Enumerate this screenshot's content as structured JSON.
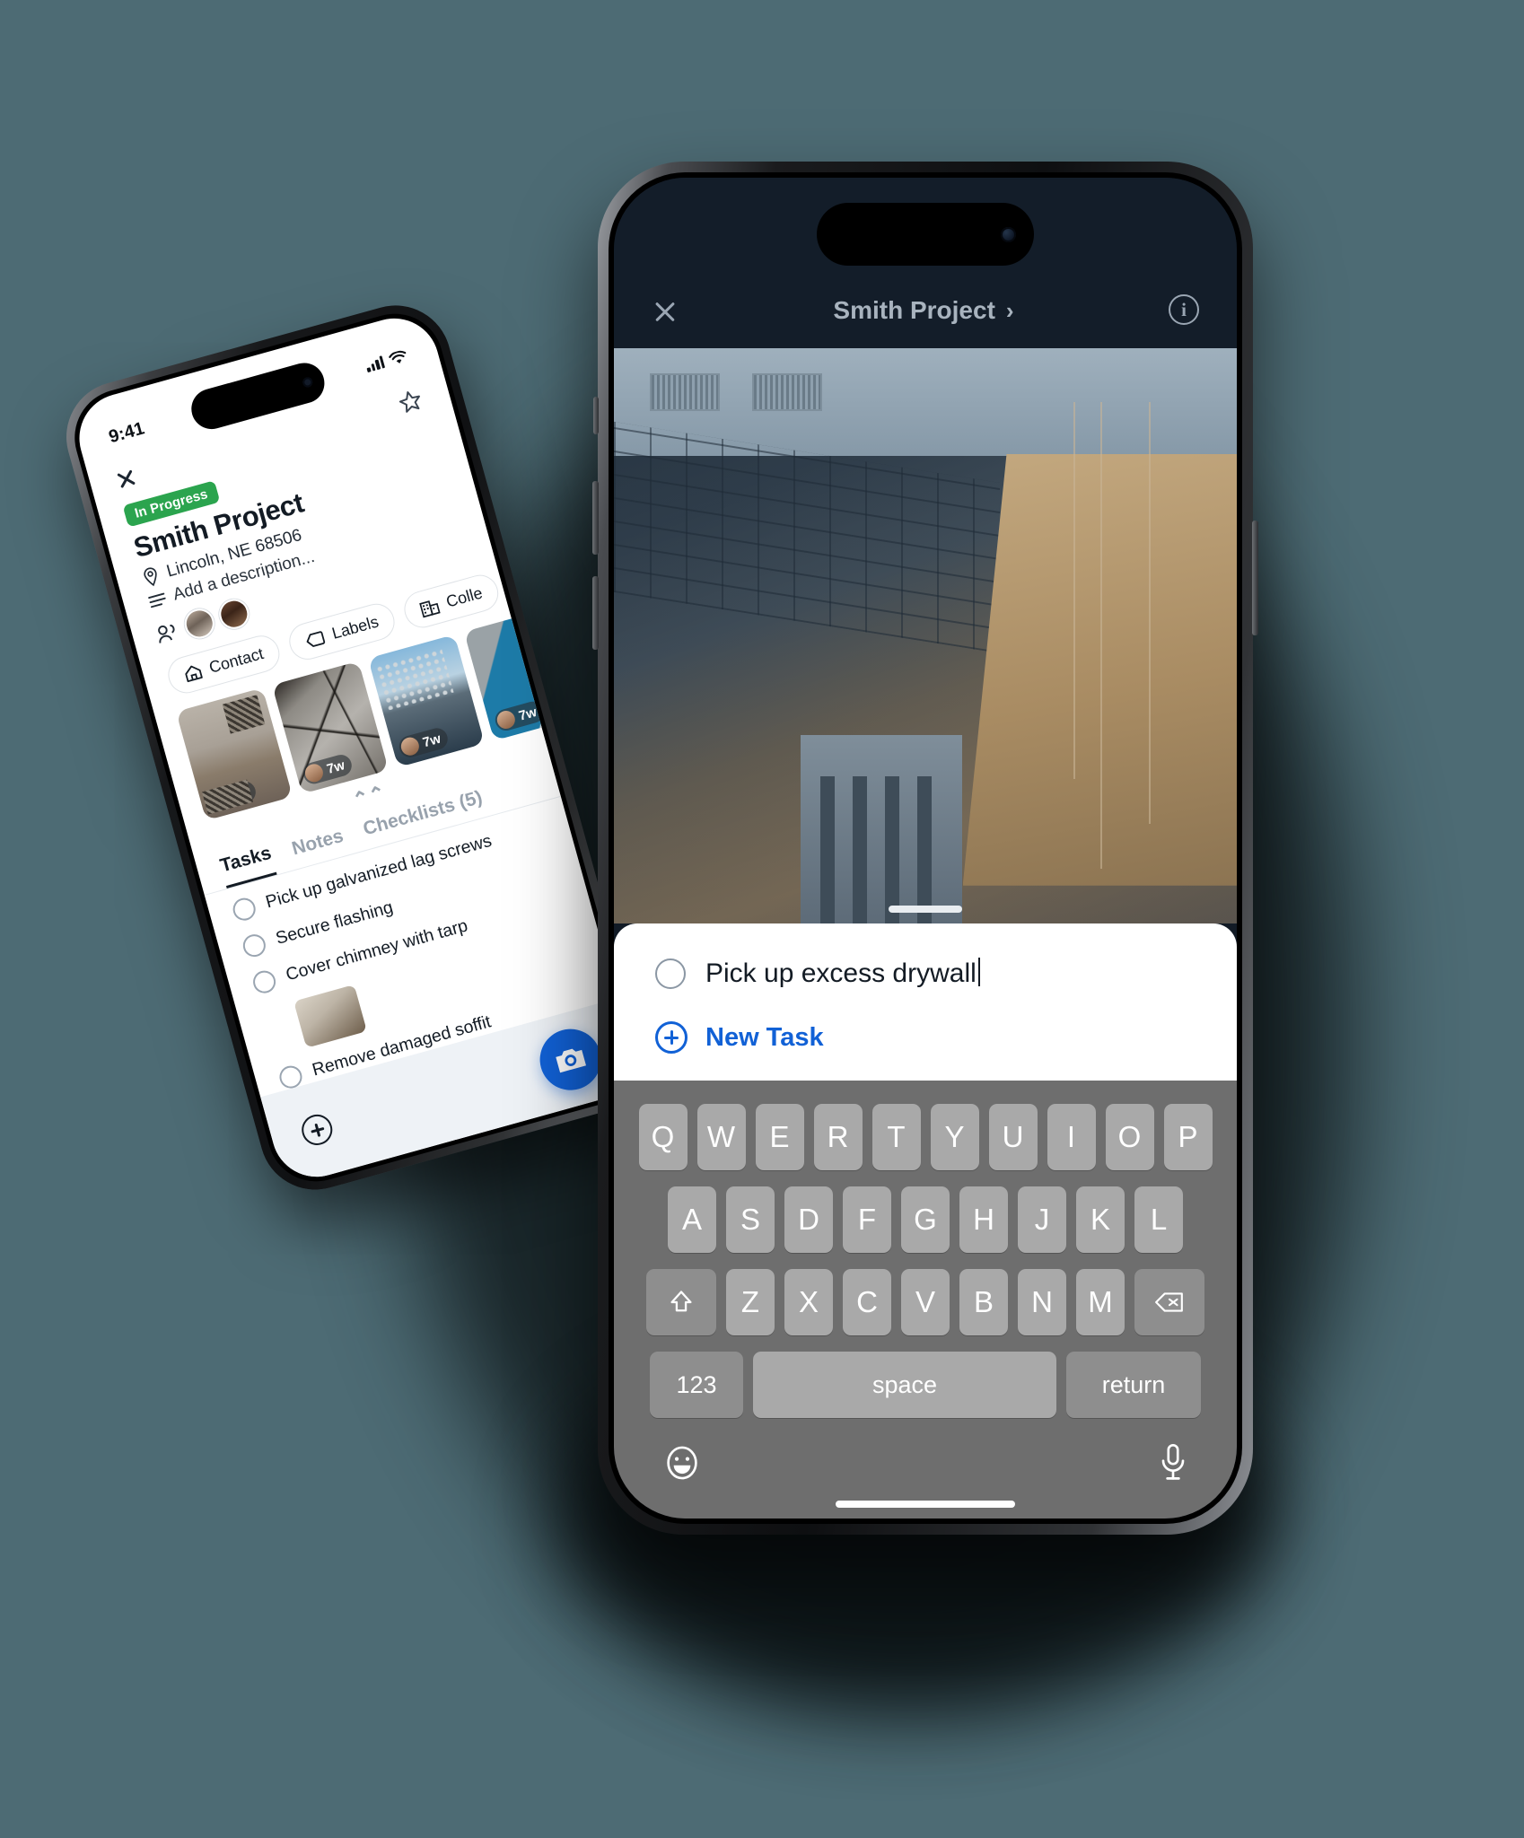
{
  "theme": {
    "page_background": "#4d6b74",
    "accent_blue": "#1161d6",
    "status_green": "#2ba44e",
    "header_dark": "#131d29",
    "keyboard_gray": "#6e6e6e"
  },
  "back_phone": {
    "status_bar": {
      "time": "9:41",
      "signal_icon": "cellular-bars-icon",
      "wifi_icon": "wifi-icon"
    },
    "close_icon": "close-icon",
    "favorite_icon": "star-icon",
    "status_badge": "In Progress",
    "title": "Smith Project",
    "location": "Lincoln, NE 68506",
    "location_icon": "map-pin-icon",
    "description_placeholder": "Add a description...",
    "description_icon": "description-lines-icon",
    "people_icon": "people-icon",
    "avatars": [
      "avatar-person-1",
      "avatar-person-2"
    ],
    "chips": [
      {
        "label": "Contact",
        "icon": "home-icon"
      },
      {
        "label": "Labels",
        "icon": "tag-icon"
      },
      {
        "label": "Colle",
        "icon": "building-icon"
      }
    ],
    "photos": [
      {
        "time_badge": "7w",
        "avatar": "avatar-user"
      },
      {
        "time_badge": "7w",
        "avatar": "avatar-user"
      },
      {
        "time_badge": "7w",
        "avatar": "avatar-user"
      },
      {
        "time_badge": "7w",
        "avatar": "avatar-user"
      }
    ],
    "collapse_icon": "chevron-double-up-icon",
    "tabs": [
      {
        "label": "Tasks",
        "active": true
      },
      {
        "label": "Notes",
        "active": false
      },
      {
        "label": "Checklists (5)",
        "active": false
      }
    ],
    "tasks": [
      {
        "label": "Pick up galvanized lag screws",
        "has_image": false
      },
      {
        "label": "Secure flashing",
        "has_image": false
      },
      {
        "label": "Cover chimney with tarp",
        "has_image": true
      },
      {
        "label": "Remove damaged soffit",
        "has_image": true
      }
    ],
    "bottom_bar": {
      "add_icon": "plus-circle-icon",
      "camera_icon": "camera-icon"
    }
  },
  "front_phone": {
    "header": {
      "close_icon": "close-icon",
      "title": "Smith Project",
      "chevron": "›",
      "info_icon": "info-circle-icon",
      "info_glyph": "i"
    },
    "photo_alt": "construction-site-photo",
    "sheet": {
      "task_value": "Pick up excess drywall",
      "task_checkbox_icon": "circle-checkbox-icon",
      "new_task_label": "New Task",
      "new_task_icon": "plus-circle-icon"
    },
    "keyboard": {
      "row1": [
        "Q",
        "W",
        "E",
        "R",
        "T",
        "Y",
        "U",
        "I",
        "O",
        "P"
      ],
      "row2": [
        "A",
        "S",
        "D",
        "F",
        "G",
        "H",
        "J",
        "K",
        "L"
      ],
      "row3": [
        "Z",
        "X",
        "C",
        "V",
        "B",
        "N",
        "M"
      ],
      "shift_icon": "shift-arrow-icon",
      "backspace_icon": "backspace-icon",
      "numeric_key": "123",
      "space_key": "space",
      "return_key": "return",
      "emoji_icon": "emoji-smiley-icon",
      "mic_icon": "microphone-icon"
    }
  }
}
